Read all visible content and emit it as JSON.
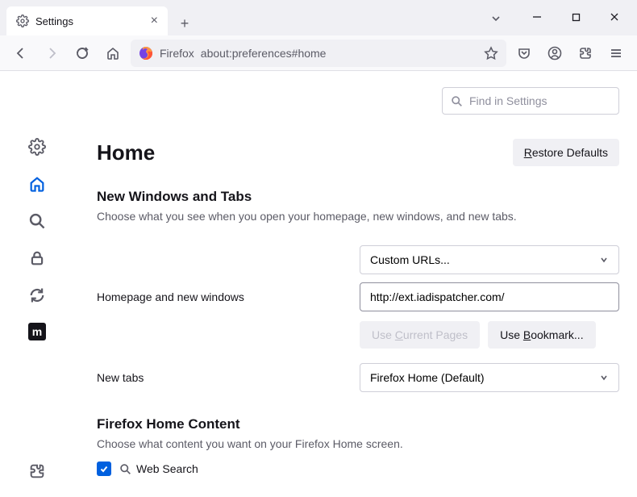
{
  "tab": {
    "title": "Settings"
  },
  "urlbar": {
    "brand": "Firefox",
    "url": "about:preferences#home"
  },
  "search": {
    "placeholder": "Find in Settings"
  },
  "page": {
    "title": "Home",
    "restore_pre": "R",
    "restore_rest": "estore Defaults",
    "sec1_title": "New Windows and Tabs",
    "sec1_desc": "Choose what you see when you open your homepage, new windows, and new tabs.",
    "label_homepage": "Homepage and new windows",
    "label_newtabs": "New tabs",
    "select_custom": "Custom URLs...",
    "select_fxhome": "Firefox Home (Default)",
    "homepage_value": "http://ext.iadispatcher.com/",
    "btn_current_pre": "Use ",
    "btn_current_u": "C",
    "btn_current_rest": "urrent Pages",
    "btn_bookmark_pre": "Use ",
    "btn_bookmark_u": "B",
    "btn_bookmark_rest": "ookmark...",
    "sec2_title": "Firefox Home Content",
    "sec2_desc": "Choose what content you want on your Firefox Home screen.",
    "chk_websearch": "Web Search"
  }
}
